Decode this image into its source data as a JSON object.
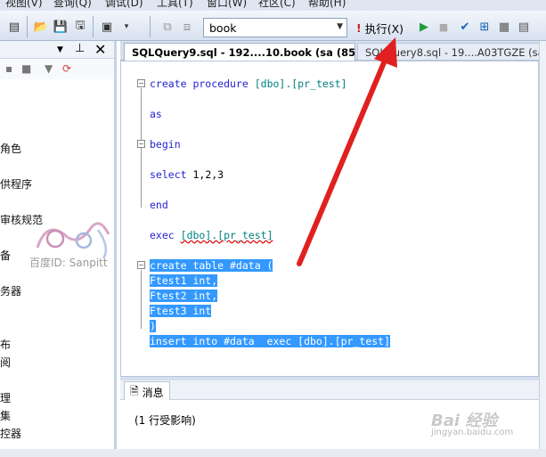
{
  "menu": {
    "items": [
      "视图(V)",
      "查询(Q)",
      "调试(D)",
      "工具(T)",
      "窗口(W)",
      "社区(C)",
      "帮助(H)"
    ]
  },
  "toolbar": {
    "database_value": "book",
    "execute_label": "执行(X)"
  },
  "sidebar": {
    "items": [
      "角色",
      "供程序",
      "审核规范",
      "备",
      "务器",
      "布",
      "阅",
      "理",
      "集",
      "控器"
    ]
  },
  "tabs": [
    {
      "label": "SQLQuery9.sql - 192....10.book (sa (85))*"
    },
    {
      "label": "SQLQuery8.sql - 19....A03TGZE (sa (..."
    }
  ],
  "code": {
    "line1_kw": "create procedure",
    "line1_name": "[dbo].[pr_test]",
    "line2": "as",
    "line3": "begin",
    "line4_kw": "select",
    "line4_rest": " 1,2,3",
    "line5": "end",
    "line6_kw": "exec",
    "line6_name": "[dbo].[pr_test]",
    "sel1": "create table #data (",
    "sel2": "Ftest1 int,",
    "sel3": "Ftest2 int,",
    "sel4": "Ftest3 int",
    "sel5": ")",
    "sel6": "insert into #data  exec [dbo].[pr_test]"
  },
  "messages": {
    "tab_label": "消息",
    "text": "(1 行受影响)"
  },
  "watermark": {
    "text": "百度ID: Sanpitt",
    "baidu": "Bai 经验",
    "baidu_url": "jingyan.baidu.com"
  },
  "colors": {
    "selection": "#3399ff",
    "keyword": "#1f1fd0",
    "arrow": "#e02020"
  }
}
